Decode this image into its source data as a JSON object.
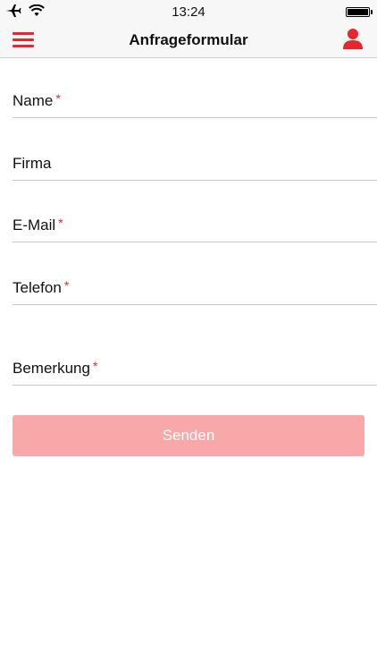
{
  "status_bar": {
    "time": "13:24",
    "icons": [
      "airplane-icon",
      "wifi-icon",
      "battery-icon"
    ]
  },
  "nav": {
    "title": "Anfrageformular",
    "left_icon": "menu-icon",
    "right_icon": "user-icon"
  },
  "form": {
    "fields": [
      {
        "label": "Name",
        "required_mark": "*"
      },
      {
        "label": "Firma",
        "required_mark": ""
      },
      {
        "label": "E-Mail",
        "required_mark": "*"
      },
      {
        "label": "Telefon",
        "required_mark": "*"
      },
      {
        "label": "Bemerkung",
        "required_mark": "*"
      }
    ],
    "submit_label": "Senden"
  },
  "colors": {
    "accent": "#e8262b",
    "button_disabled": "#f8a8a8"
  }
}
